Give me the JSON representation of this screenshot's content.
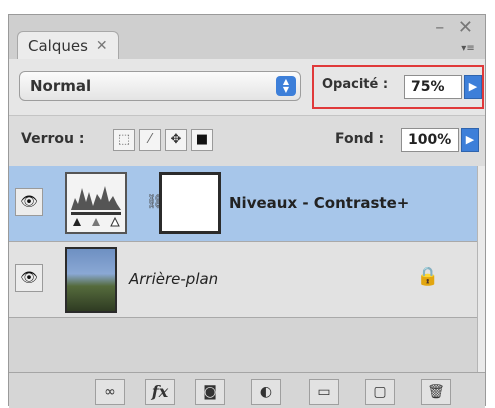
{
  "panel": {
    "tab_label": "Calques",
    "tab_close": "✕",
    "window_controls": "– ✕",
    "menu_arrow": "▾≡"
  },
  "blend": {
    "mode": "Normal",
    "opacity_label": "Opacité :",
    "opacity_value": "75%",
    "highlight_color": "#e0393a"
  },
  "locks": {
    "label": "Verrou :",
    "fill_label": "Fond :",
    "fill_value": "100%",
    "buttons": [
      "transparency-lock",
      "pixel-lock",
      "position-lock",
      "all-lock"
    ]
  },
  "layers": [
    {
      "name": "Niveaux - Contraste+",
      "selected": true,
      "type": "adjustment",
      "visible": true
    },
    {
      "name": "Arrière-plan",
      "selected": false,
      "type": "background",
      "locked": true,
      "visible": true
    }
  ],
  "toolbar": {
    "items": [
      "link-layers",
      "fx",
      "add-mask",
      "adjustment-layer",
      "new-group",
      "new-layer",
      "delete-layer"
    ],
    "fx_label": "fx"
  },
  "colors": {
    "selection": "#a7c6ea",
    "accent": "#3d7fd9"
  }
}
